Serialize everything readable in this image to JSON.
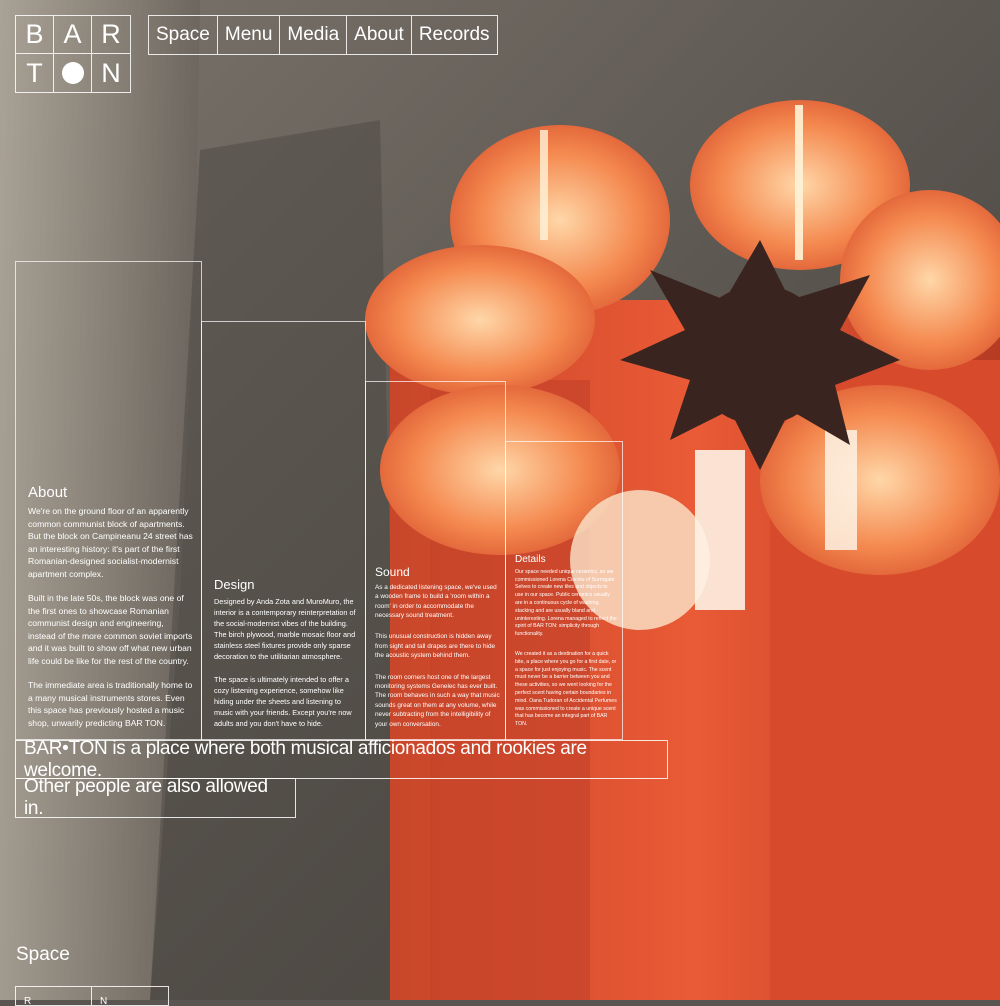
{
  "colors": {
    "accent": "#ffffff",
    "lamp": "#e8502f",
    "wall": "#5a5550"
  },
  "logo": {
    "letters": [
      "B",
      "A",
      "R",
      "T",
      "N"
    ]
  },
  "nav": {
    "items": [
      "Space",
      "Menu",
      "Media",
      "About",
      "Records"
    ]
  },
  "about": {
    "title": "About",
    "paragraphs": [
      "We're on the ground floor of an apparently common communist block of apartments. But the block on Campineanu 24 street has an interesting history: it's part of the first Romanian-designed socialist-modernist apartment complex.",
      "Built in the late 50s, the block was one of the first ones to showcase Romanian communist design and engineering, instead of the more common soviet imports and it was built to show off what new urban life could be like for the rest of the country.",
      "The immediate area is traditionally home to a many musical instruments stores. Even this space has previously hosted a music shop, unwarily predicting BAR TON."
    ]
  },
  "design": {
    "title": "Design",
    "paragraphs": [
      "Designed by Anda Zota and MuroMuro, the interior is a contemporary reinterpretation of the social-modernist vibes of the building. The birch plywood, marble mosaic floor and stainless steel fixtures provide only sparse decoration to the utilitarian atmosphere.",
      "The space is ultimately intended to offer a cozy listening experience, somehow like hiding under the sheets and listening to music with your friends. Except you're now adults and you don't have to hide."
    ]
  },
  "sound": {
    "title": "Sound",
    "paragraphs": [
      "As a dedicated listening space, we've used a wooden frame to build a 'room within a room' in order to accommodate the necessary sound treatment.",
      "This unusual construction is hidden away from sight and tall drapes are there to hide the acoustic system behind them.",
      "The room corners host one of the largest monitoring systems Genelec has ever built. The room behaves in such a way that music sounds great on them at any volume, while never subtracting from the intelligibility of your own conversation."
    ]
  },
  "details": {
    "title": "Details",
    "paragraphs": [
      "Our space needed unique ceramics, so we commissioned Lorena Ciocoiu of Surrogate Selves to create new tiles and objects to use in our space. Public ceramics usually are in a continuous cycle of washing, stacking and are usually bland and uninteresting. Lorena managed to reflect the spirit of BAR TON: simplicity through functionality.",
      "We created it as a destination for a quick bite, a place where you go for a first date, or a space for just enjoying music. The scent must never be a barrier between you and these activities, so we went looking for the perfect scent having certain boundaries in mind. Oana Tudoran of Accidental Perfumes was commissioned to create a unique scent that has become an integral part of BAR TON."
    ]
  },
  "banner": {
    "line1": "BAR•TON is a place where both musical afficionados and rookies are welcome.",
    "line2": "Other people are also allowed in."
  },
  "space": {
    "title": "Space",
    "boxes": [
      "R",
      "N"
    ]
  }
}
